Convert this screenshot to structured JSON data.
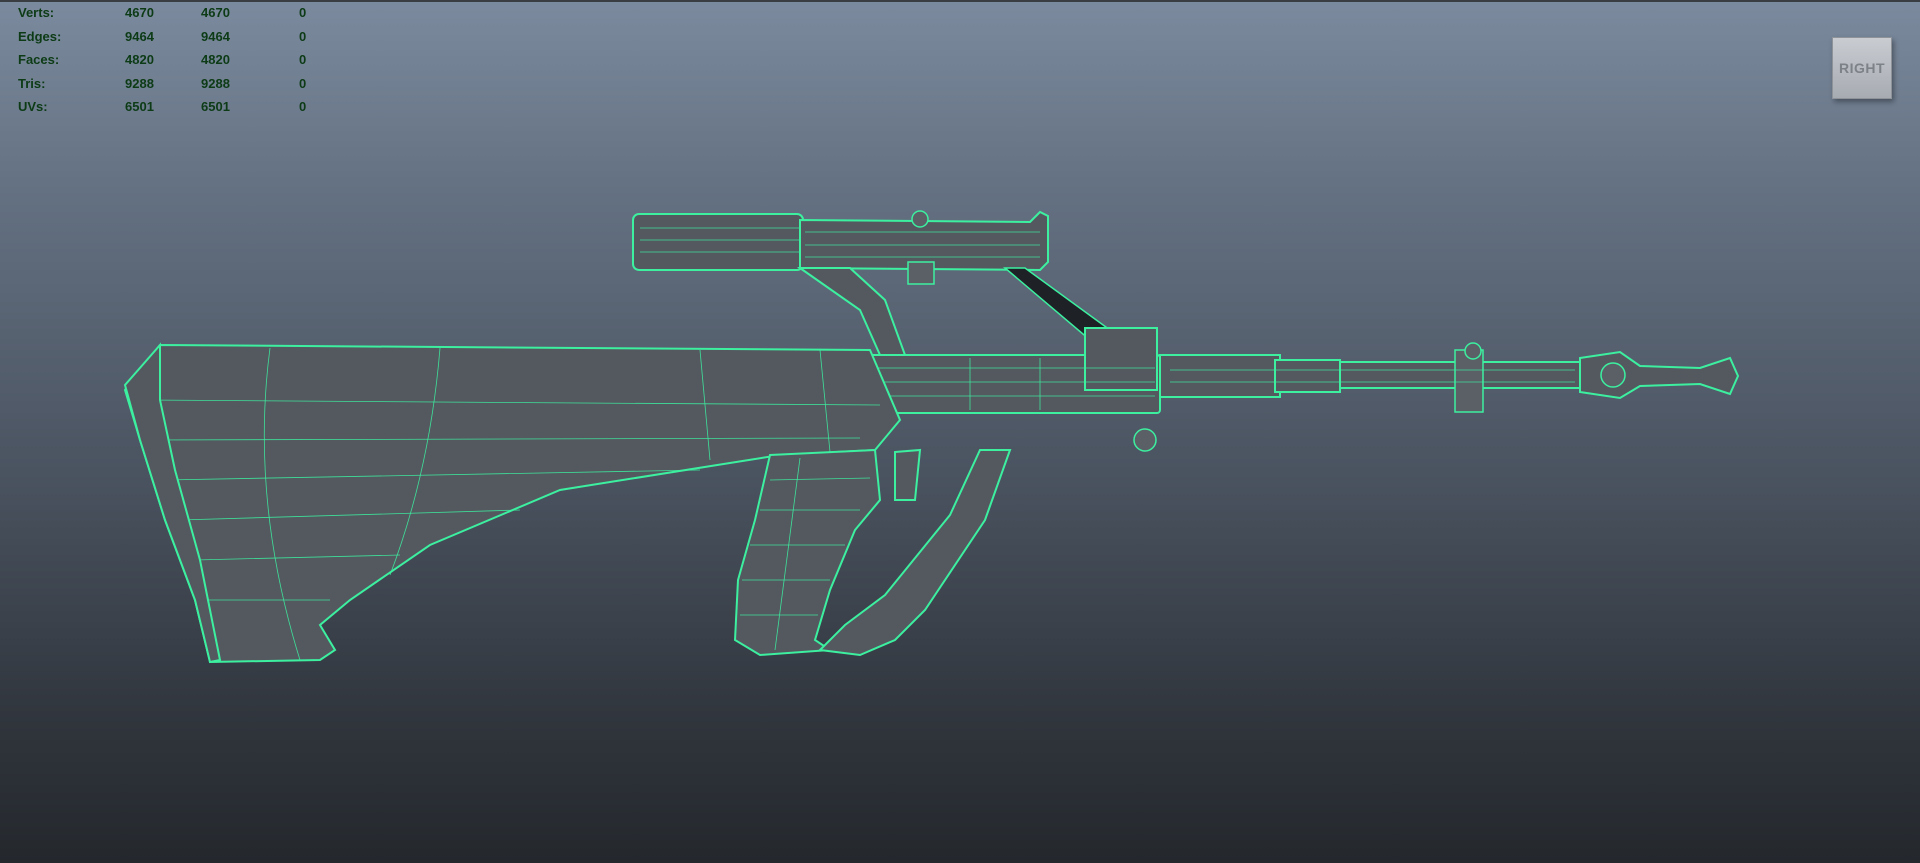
{
  "stats": {
    "rows": [
      {
        "label": "Verts:",
        "values": [
          "4670",
          "4670",
          "0"
        ]
      },
      {
        "label": "Edges:",
        "values": [
          "9464",
          "9464",
          "0"
        ]
      },
      {
        "label": "Faces:",
        "values": [
          "4820",
          "4820",
          "0"
        ]
      },
      {
        "label": "Tris:",
        "values": [
          "9288",
          "9288",
          "0"
        ]
      },
      {
        "label": "UVs:",
        "values": [
          "6501",
          "6501",
          "0"
        ]
      }
    ]
  },
  "viewcube": {
    "label": "RIGHT"
  },
  "colors": {
    "wireframe": "#3cf0a0",
    "hud_text": "#0c3b15",
    "background_top": "#7b8a9e",
    "background_bottom": "#24282d"
  },
  "scene": {
    "object_icon": "rifle-mesh-icon"
  }
}
